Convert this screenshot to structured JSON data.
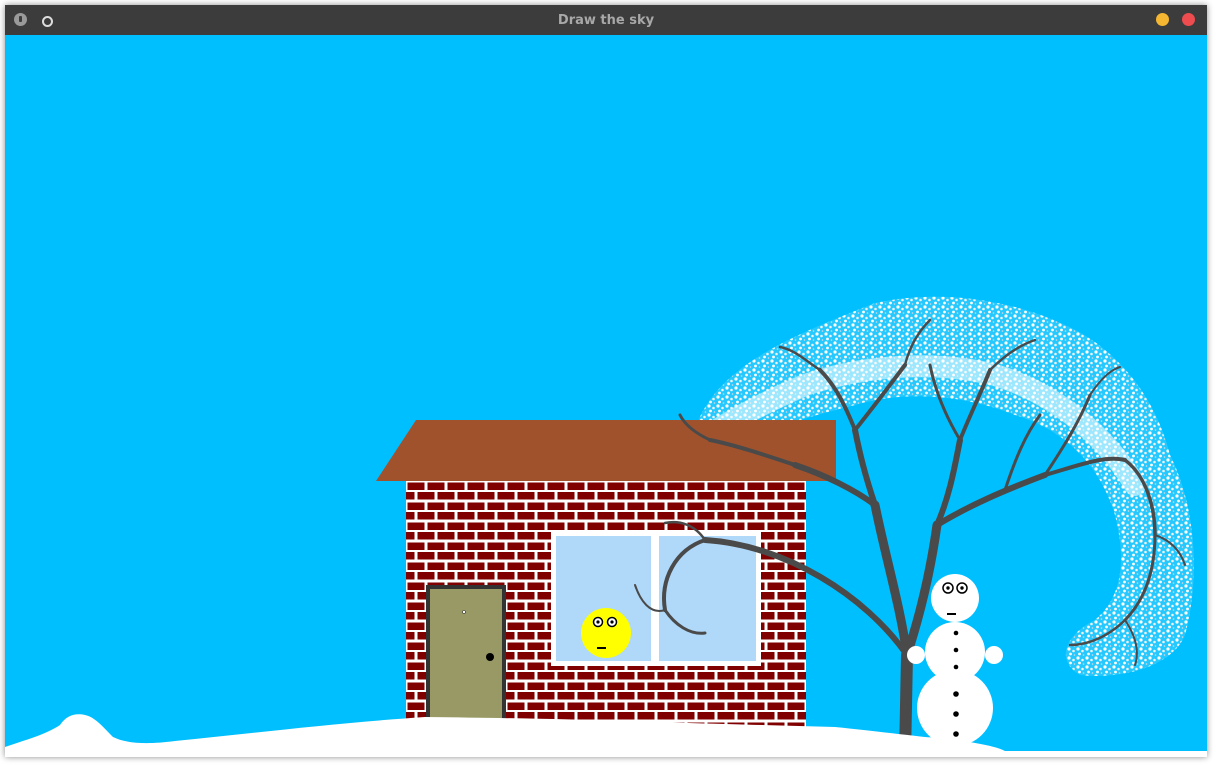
{
  "window": {
    "title": "Draw the sky"
  },
  "titlebar": {
    "menu_icon": "info-icon",
    "pin_icon": "pin-icon",
    "minimize_icon": "minimize-icon",
    "close_icon": "close-icon"
  },
  "scene": {
    "sky_color": "#00bfff",
    "snow_color": "#ffffff",
    "roof_color": "#a0522d",
    "brick_color": "#800000",
    "mortar_color": "#ffffff",
    "door_color": "#999966",
    "window_glass_color": "#b0d8f8",
    "sun_face_color": "#ffff00",
    "tree_color": "#4a4a4a"
  }
}
